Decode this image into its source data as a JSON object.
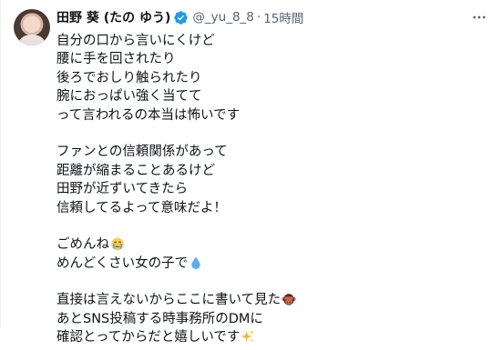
{
  "tweet": {
    "display_name": "田野 葵 (たの ゆう)",
    "handle": "@_yu_8_8",
    "separator": "·",
    "time": "15時間",
    "lines": [
      "自分の口から言いにくけど",
      "腰に手を回されたり",
      "後ろでおしり触られたり",
      "腕におっぱい強く当てて",
      "って言われるの本当は怖いです",
      "",
      "ファンとの信頼関係があって",
      "距離が縮まることあるけど",
      "田野が近ずいてきたら",
      "信頼してるよって意味だよ！",
      "",
      "ごめんね",
      "めんどくさい女の子で",
      "",
      "直接は言えないからここに書いて見た",
      "あとSNS投稿する時事務所のDMに",
      "確認とってからだと嬉しいです"
    ],
    "line_emojis": {
      "11": "crying-face-icon",
      "12": "droplet-icon",
      "14": "see-no-evil-monkey-icon",
      "16": "sparkles-icon"
    },
    "colors": {
      "verified": "#1d9bf0",
      "secondary_text": "#536471",
      "primary_text": "#0f1419"
    }
  }
}
